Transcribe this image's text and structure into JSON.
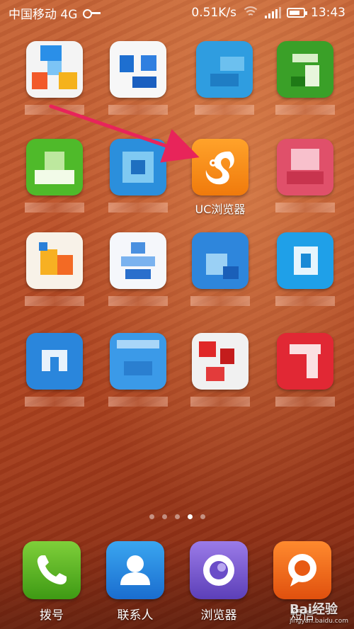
{
  "status_bar": {
    "carrier": "中国移动 4G",
    "net_speed": "0.51K/s",
    "time": "13:43",
    "battery_level": 0.8,
    "signal_bars": 4
  },
  "apps": {
    "highlighted_label": "UC浏览器"
  },
  "pager": {
    "count": 5,
    "active_index": 3
  },
  "dock": {
    "dialer_label": "拨号",
    "contacts_label": "联系人",
    "browser_label": "浏览器",
    "messages_label": "短信"
  },
  "watermark": {
    "brand": "Bai",
    "brand_suffix": "经验",
    "url": "jingyan.baidu.com"
  },
  "colors": {
    "arrow": "#e8245a",
    "uc_orange": "#f58a14"
  }
}
